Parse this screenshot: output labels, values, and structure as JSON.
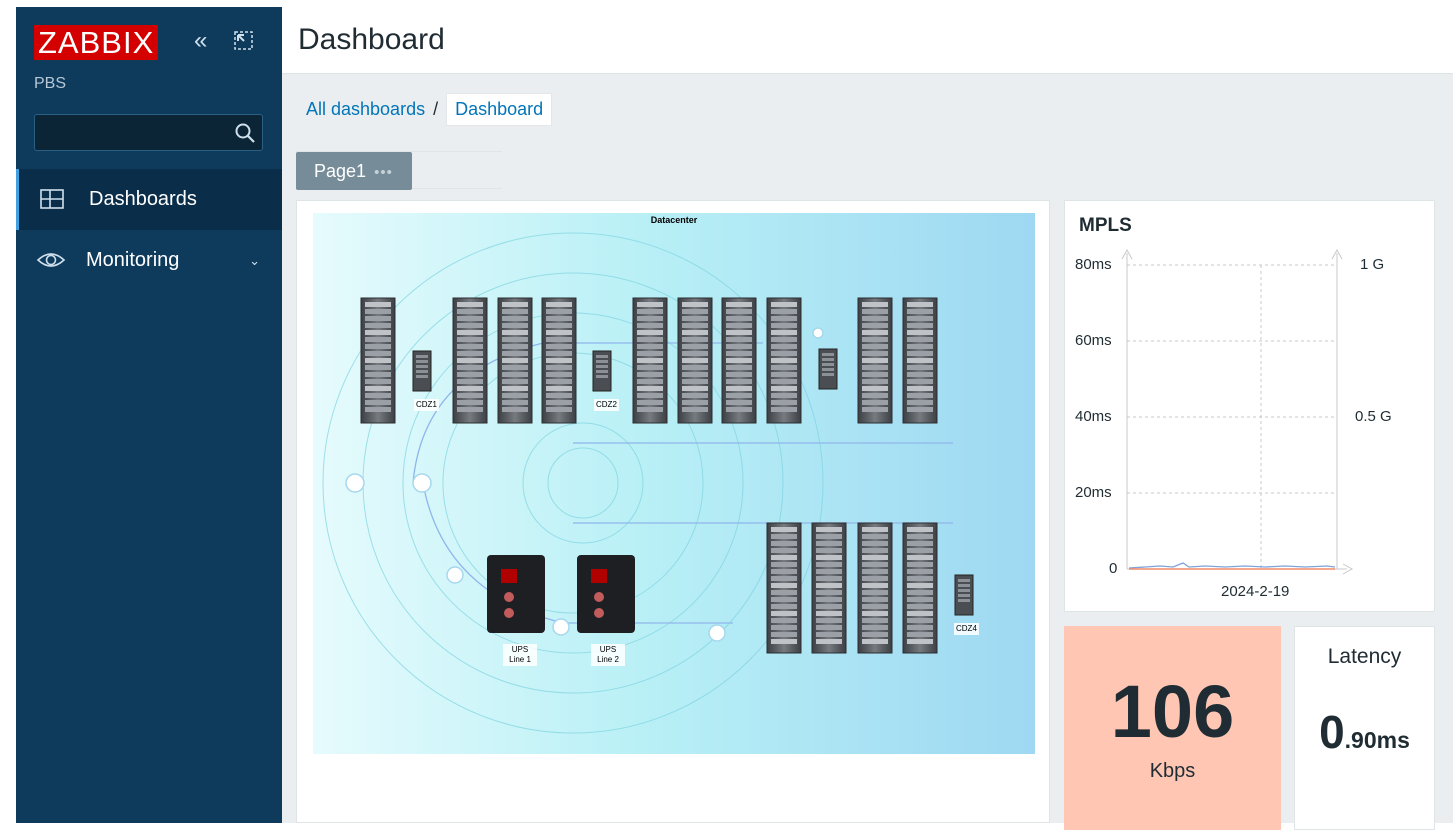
{
  "sidebar": {
    "logo_text": "ZABBIX",
    "server_name": "PBS",
    "search": {
      "value": "",
      "placeholder": ""
    },
    "menu": [
      {
        "label": "Dashboards",
        "icon": "dashboard-grid-icon",
        "active": true
      },
      {
        "label": "Monitoring",
        "icon": "eye-icon",
        "active": false,
        "has_submenu": true
      }
    ],
    "collapse_icon": "double-chevron-left-icon",
    "kiosk_icon": "kiosk-mode-icon"
  },
  "header": {
    "title": "Dashboard"
  },
  "breadcrumb": {
    "items": [
      "All dashboards",
      "Dashboard"
    ],
    "separator": "/"
  },
  "tabs": [
    {
      "label": "Page1",
      "menu_glyph": "•••"
    }
  ],
  "map_widget": {
    "title": "Datacenter",
    "labels": {
      "cdz1": "CDZ1",
      "cdz2": "CDZ2",
      "cdz4": "CDZ4",
      "ups1": "UPS Line 1",
      "ups2": "UPS Line 2"
    }
  },
  "graph_widget": {
    "title": "MPLS",
    "left_axis_ticks": [
      "80ms",
      "60ms",
      "40ms",
      "20ms",
      "0"
    ],
    "right_axis_ticks": [
      "1 G",
      "0.5 G"
    ],
    "x_label": "2024-2-19"
  },
  "kbps_widget": {
    "value": "106",
    "unit": "Kbps",
    "bg_color": "#ffc6b3"
  },
  "latency_widget": {
    "title": "Latency",
    "value_int": "0",
    "value_dec": ".90",
    "unit": "ms"
  },
  "colors": {
    "sidebar_bg": "#0e3a5c",
    "logo_red": "#d40000",
    "link_blue": "#0275b8",
    "tab_gray": "#768d99"
  }
}
